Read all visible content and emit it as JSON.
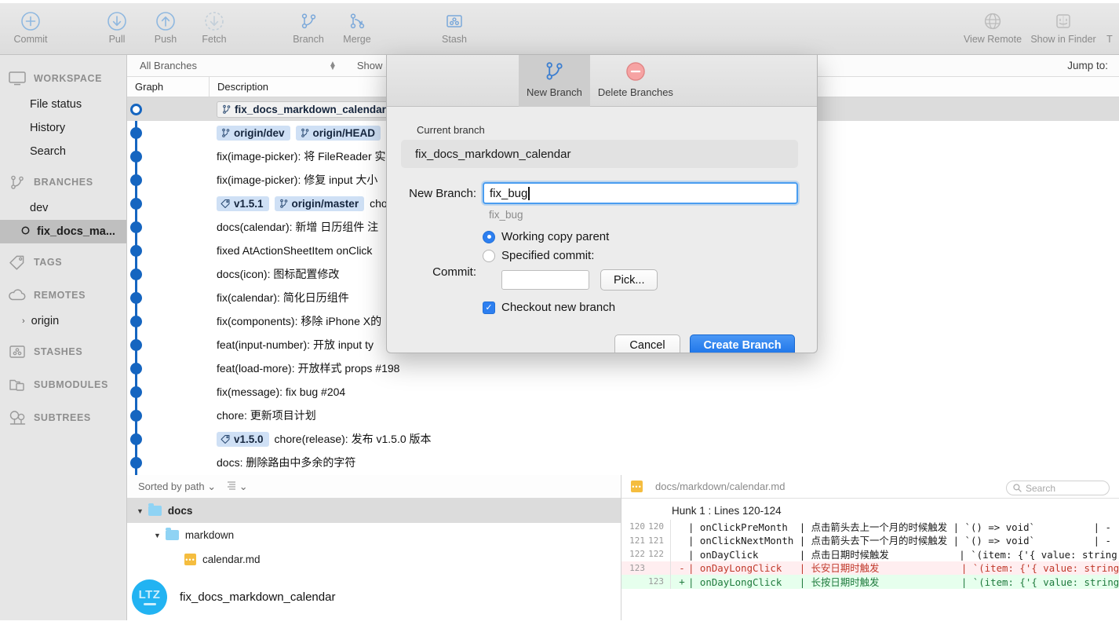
{
  "toolbar": {
    "left_buttons": [
      {
        "label": "Commit",
        "icon": "plus-circle-icon"
      },
      {
        "label": "Pull",
        "icon": "arrow-down-circle-icon"
      },
      {
        "label": "Push",
        "icon": "arrow-up-circle-icon"
      },
      {
        "label": "Fetch",
        "icon": "arrow-down-dashed-circle-icon"
      },
      {
        "label": "Branch",
        "icon": "branch-icon"
      },
      {
        "label": "Merge",
        "icon": "merge-icon"
      },
      {
        "label": "Stash",
        "icon": "stash-icon"
      }
    ],
    "right_buttons": [
      {
        "label": "View Remote",
        "icon": "globe-icon"
      },
      {
        "label": "Show in Finder",
        "icon": "finder-icon"
      },
      {
        "label": "T",
        "icon": "terminal-icon"
      }
    ]
  },
  "sidebar": {
    "sections": [
      {
        "title": "WORKSPACE",
        "icon": "monitor-icon",
        "items": [
          {
            "label": "File status"
          },
          {
            "label": "History"
          },
          {
            "label": "Search"
          }
        ]
      },
      {
        "title": "BRANCHES",
        "icon": "branch-icon",
        "items": [
          {
            "label": "dev"
          },
          {
            "label": "fix_docs_ma...",
            "selected": true,
            "icon": "branch-dot-icon"
          }
        ]
      },
      {
        "title": "TAGS",
        "icon": "tag-icon",
        "items": []
      },
      {
        "title": "REMOTES",
        "icon": "cloud-icon",
        "items": [
          {
            "label": "origin",
            "chevron": "›"
          }
        ]
      },
      {
        "title": "STASHES",
        "icon": "stash-icon",
        "items": []
      },
      {
        "title": "SUBMODULES",
        "icon": "submodule-icon",
        "items": []
      },
      {
        "title": "SUBTREES",
        "icon": "subtree-icon",
        "items": []
      }
    ]
  },
  "commit_list": {
    "filter_value": "All Branches",
    "show_remote_label": "Show Remote",
    "jump_to_label": "Jump to:",
    "columns": {
      "graph": "Graph",
      "description": "Description"
    },
    "rows": [
      {
        "selected": true,
        "node": "open",
        "badges": [
          {
            "text": "fix_docs_markdown_calendar",
            "kind": "current",
            "icon": "branch-icon"
          }
        ],
        "message": ""
      },
      {
        "node": "filled",
        "badges": [
          {
            "text": "origin/dev",
            "kind": "remote",
            "icon": "branch-icon"
          },
          {
            "text": "origin/HEAD",
            "kind": "remote",
            "icon": "branch-icon"
          },
          {
            "text": "",
            "kind": "remote",
            "icon": "branch-icon"
          }
        ],
        "message": ""
      },
      {
        "node": "filled",
        "badges": [],
        "message": "fix(image-picker): 将 FileReader 实"
      },
      {
        "node": "filled",
        "badges": [],
        "message": "fix(image-picker): 修复 input 大小"
      },
      {
        "node": "filled",
        "badges": [
          {
            "text": "v1.5.1",
            "kind": "tag",
            "icon": "tag-icon"
          },
          {
            "text": "origin/master",
            "kind": "remote",
            "icon": "branch-icon"
          }
        ],
        "message": "chore"
      },
      {
        "node": "filled",
        "badges": [],
        "message": "docs(calendar): 新增 日历组件 注"
      },
      {
        "node": "filled",
        "badges": [],
        "message": "fixed AtActionSheetItem onClick"
      },
      {
        "node": "filled",
        "badges": [],
        "message": "docs(icon): 图标配置修改"
      },
      {
        "node": "filled",
        "badges": [],
        "message": "fix(calendar): 简化日历组件"
      },
      {
        "node": "filled",
        "badges": [],
        "message": "fix(components): 移除 iPhone X的"
      },
      {
        "node": "filled",
        "badges": [],
        "message": "feat(input-number): 开放 input ty"
      },
      {
        "node": "filled",
        "badges": [],
        "message": "feat(load-more): 开放样式 props #198"
      },
      {
        "node": "filled",
        "badges": [],
        "message": "fix(message): fix bug #204"
      },
      {
        "node": "filled",
        "badges": [],
        "message": "chore: 更新项目计划"
      },
      {
        "node": "filled",
        "badges": [
          {
            "text": "v1.5.0",
            "kind": "tag",
            "icon": "tag-icon"
          }
        ],
        "message": "chore(release): 发布 v1.5.0 版本"
      },
      {
        "node": "filled",
        "badges": [],
        "message": "docs: 删除路由中多余的字符"
      }
    ]
  },
  "file_panel": {
    "sort_label": "Sorted by path",
    "view_label": "",
    "search_placeholder": "Search",
    "tree": [
      {
        "label": "docs",
        "depth": 0,
        "type": "folder",
        "expanded": true,
        "highlighted": true
      },
      {
        "label": "markdown",
        "depth": 1,
        "type": "folder",
        "expanded": true
      },
      {
        "label": "calendar.md",
        "depth": 2,
        "type": "file"
      }
    ],
    "author": {
      "initials": "LTZ",
      "name": "fix_docs_markdown_calendar"
    }
  },
  "diff_panel": {
    "file_path": "docs/markdown/calendar.md",
    "hunk_header": "Hunk 1 : Lines 120-124",
    "lines": [
      {
        "old": "120",
        "new": "120",
        "sign": "",
        "type": "ctx",
        "text": "| onClickPreMonth  | 点击箭头去上一个月的时候触发 | `() => void`          | -"
      },
      {
        "old": "121",
        "new": "121",
        "sign": "",
        "type": "ctx",
        "text": "| onClickNextMonth | 点击箭头去下一个月的时候触发 | `() => void`          | -"
      },
      {
        "old": "122",
        "new": "122",
        "sign": "",
        "type": "ctx",
        "text": "| onDayClick       | 点击日期时候触发            | `(item: {'{ value: string }'"
      },
      {
        "old": "123",
        "new": "",
        "sign": "-",
        "type": "del",
        "text": "| onDayLongClick   | 长安日期时触发              | `(item: {'{ value: string }'"
      },
      {
        "old": "",
        "new": "123",
        "sign": "+",
        "type": "add",
        "text": "| onDayLongClick   | 长按日期时触发              | `(item: {'{ value: string }'"
      }
    ]
  },
  "dialog": {
    "tabs": [
      {
        "label": "New Branch",
        "icon": "branch-icon",
        "active": true
      },
      {
        "label": "Delete Branches",
        "icon": "minus-circle-icon",
        "active": false
      }
    ],
    "current_branch_label": "Current branch",
    "current_branch_value": "fix_docs_markdown_calendar",
    "new_branch_label": "New Branch:",
    "new_branch_value": "fix_bug",
    "new_branch_hint": "fix_bug",
    "commit_label": "Commit:",
    "radio_working_copy": "Working copy parent",
    "radio_specified": "Specified commit:",
    "specified_commit_value": "",
    "pick_button": "Pick...",
    "checkout_label": "Checkout new branch",
    "checkout_checked": true,
    "cancel_button": "Cancel",
    "create_button": "Create Branch"
  },
  "colors": {
    "accent": "#2d7ff0",
    "graph": "#1565c0",
    "badge_bg": "#cfe0f5",
    "add_bg": "#e6ffed",
    "del_bg": "#ffeef0",
    "avatar": "#22b3f2"
  }
}
